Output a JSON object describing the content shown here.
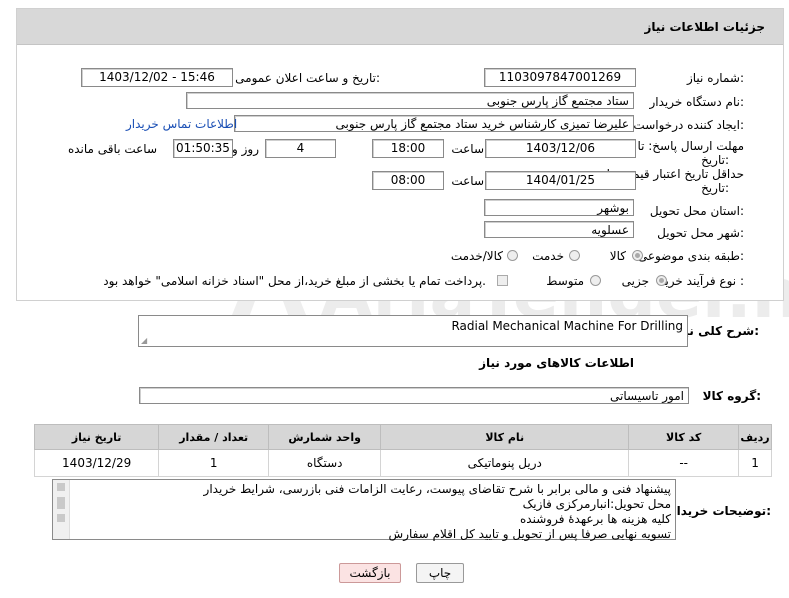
{
  "panel_title": "جزئیات اطلاعات نیاز",
  "fields": {
    "need_number_label": "شماره نیاز:",
    "need_number": "1103097847001269",
    "announce_label": "تاریخ و ساعت اعلان عمومی:",
    "announce_value": "1403/12/02 - 15:46",
    "buyer_org_label": "نام دستگاه خریدار:",
    "buyer_org": "ستاد مجتمع گاز پارس جنوبی",
    "creator_label": "ایجاد کننده درخواست:",
    "creator": "علیرضا تمیزی کارشناس خرید ستاد مجتمع گاز پارس جنوبی",
    "contact_link": "اطلاعات تماس خریدار",
    "deadline_label_1": "مهلت ارسال پاسخ: تا",
    "deadline_label_2": "تاریخ:",
    "deadline_date": "1403/12/06",
    "time_label": "ساعت",
    "deadline_time": "18:00",
    "days_value": "4",
    "days_label": "روز و",
    "remaining_time": "01:50:35",
    "remaining_label": "ساعت باقی مانده",
    "validity_label_1": "حداقل تاریخ اعتبار قیمت: تا",
    "validity_label_2": "تاریخ:",
    "validity_date": "1404/01/25",
    "validity_time_label": "ساعت",
    "validity_time": "08:00",
    "province_label": "استان محل تحویل:",
    "province": "بوشهر",
    "city_label": "شهر محل تحویل:",
    "city": "عسلویه",
    "category_label": "طبقه بندی موضوعی:",
    "category_options": [
      "کالا",
      "خدمت",
      "کالا/خدمت"
    ],
    "process_label": "نوع فرآیند خرید :",
    "process_options": [
      "جزیی",
      "متوسط"
    ],
    "process_note": "پرداخت تمام یا بخشی از مبلغ خرید،از محل \"اسناد خزانه اسلامی\" خواهد بود."
  },
  "summary_label": "شرح کلی نیاز:",
  "summary_value": "Radial Mechanical Machine For Drilling",
  "goods_info_title": "اطلاعات کالاهای مورد نیاز",
  "goods_group_label": "گروه کالا:",
  "goods_group": "امور تاسیساتی",
  "table": {
    "headers": [
      "ردیف",
      "کد کالا",
      "نام کالا",
      "واحد شمارش",
      "تعداد / مقدار",
      "تاریخ نیاز"
    ],
    "rows": [
      [
        "1",
        "--",
        "دریل پنوماتیکی",
        "دستگاه",
        "1",
        "1403/12/29"
      ]
    ]
  },
  "buyer_notes_label": "توضیحات خریدار:",
  "buyer_notes": [
    "پیشنهاد فنی و مالی برابر با شرح تقاضای پیوست، رعایت الزامات فنی بازرسی، شرایط خریدار",
    "محل تحویل:انبارمرکزی فازیک",
    "کلیه هزینه ها برعهدهٔ فروشنده",
    "تسویه نهایی صرفا پس از تحویل و تایید کل اقلام سفارش"
  ],
  "buttons": {
    "print": "چاپ",
    "back": "بازگشت"
  },
  "watermark": "AriaTender.neT"
}
